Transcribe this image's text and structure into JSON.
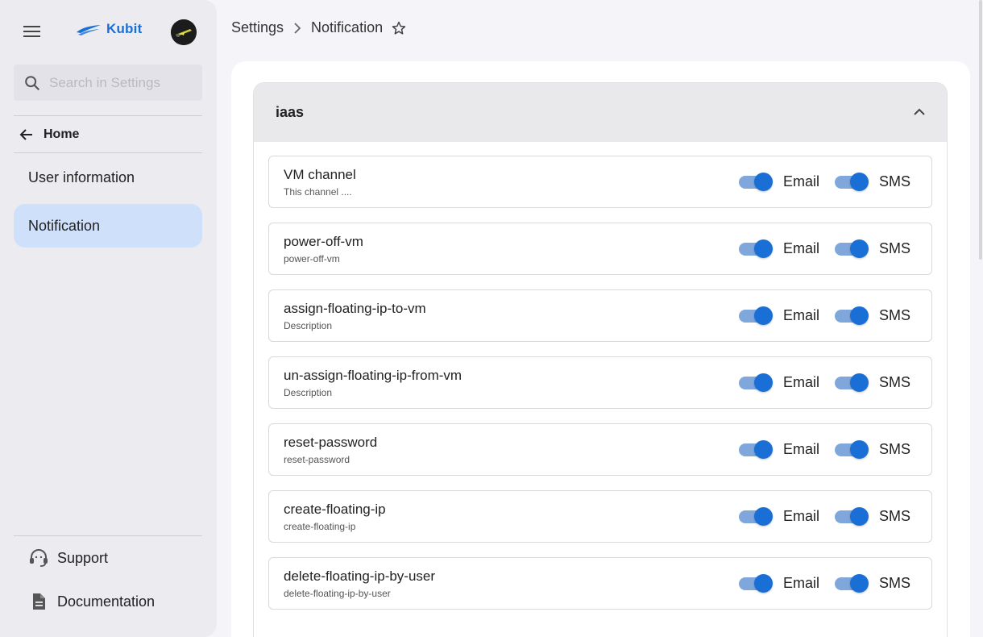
{
  "app": {
    "name": "Kubit"
  },
  "search": {
    "placeholder": "Search in Settings"
  },
  "sidebar": {
    "home_label": "Home",
    "items": [
      {
        "label": "User information",
        "active": false
      },
      {
        "label": "Notification",
        "active": true
      }
    ],
    "bottom": [
      {
        "label": "Support",
        "icon": "headset-icon"
      },
      {
        "label": "Documentation",
        "icon": "document-icon"
      }
    ]
  },
  "breadcrumb": {
    "root": "Settings",
    "current": "Notification"
  },
  "section": {
    "title": "iaas",
    "expanded": true
  },
  "toggle_labels": {
    "email": "Email",
    "sms": "SMS"
  },
  "notifications": [
    {
      "title": "VM channel",
      "description": "This channel ....",
      "email": true,
      "sms": true
    },
    {
      "title": "power-off-vm",
      "description": "power-off-vm",
      "email": true,
      "sms": true
    },
    {
      "title": "assign-floating-ip-to-vm",
      "description": "Description",
      "email": true,
      "sms": true
    },
    {
      "title": "un-assign-floating-ip-from-vm",
      "description": "Description",
      "email": true,
      "sms": true
    },
    {
      "title": "reset-password",
      "description": "reset-password",
      "email": true,
      "sms": true
    },
    {
      "title": "create-floating-ip",
      "description": "create-floating-ip",
      "email": true,
      "sms": true
    },
    {
      "title": "delete-floating-ip-by-user",
      "description": "delete-floating-ip-by-user",
      "email": true,
      "sms": true
    }
  ],
  "colors": {
    "accent": "#1a6fd6",
    "active_nav": "#cfe0fb",
    "toggle_track": "#7fa7dc"
  }
}
